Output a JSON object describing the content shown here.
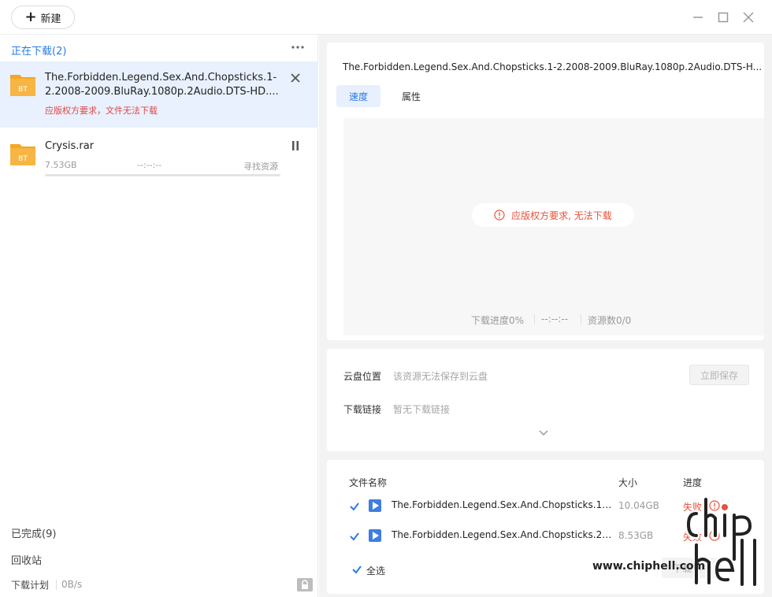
{
  "toolbar": {
    "new_label": "新建"
  },
  "window_controls": [
    "minimize-icon",
    "maximize-icon",
    "close-icon"
  ],
  "sidebar": {
    "downloading_title": "正在下载(2)",
    "tasks": [
      {
        "name": "The.Forbidden.Legend.Sex.And.Chopsticks.1-2.2008-2009.BluRay.1080p.2Audio.DTS-HD....",
        "icon": "bt-folder-icon",
        "icon_text": "BT",
        "error": "应版权方要求，文件无法下载",
        "action_icon": "close-icon"
      },
      {
        "name": "Crysis.rar",
        "icon": "bt-folder-icon",
        "icon_text": "BT",
        "size": "7.53GB",
        "eta": "--:--:--",
        "status": "寻找资源",
        "action_icon": "pause-icon",
        "progress": 0
      }
    ],
    "completed": "已完成(9)",
    "recycle": "回收站",
    "plan": "下载计划",
    "speed": "0B/s"
  },
  "detail": {
    "title": "The.Forbidden.Legend.Sex.And.Chopsticks.1-2.2008-2009.BluRay.1080p.2Audio.DTS-H...",
    "tabs": [
      "速度",
      "属性"
    ],
    "error_message": "应版权方要求, 无法下载",
    "progress_text": "下载进度0%",
    "eta_text": "--:--:--",
    "sources_text": "资源数0/0",
    "cloud_label": "云盘位置",
    "cloud_value": "该资源无法保存到云盘",
    "save_button": "立即保存",
    "link_label": "下载链接",
    "link_value": "暂无下载链接"
  },
  "file_list": {
    "headers": {
      "name": "文件名称",
      "size": "大小",
      "progress": "进度"
    },
    "rows": [
      {
        "checked": true,
        "name": "The.Forbidden.Legend.Sex.And.Chopsticks.1....",
        "size": "10.04GB",
        "status": "失败"
      },
      {
        "checked": true,
        "name": "The.Forbidden.Legend.Sex.And.Chopsticks.2....",
        "size": "8.53GB",
        "status": "失败"
      }
    ],
    "select_all": "全选",
    "download_selected": "下载选中"
  },
  "watermark": "www.chiphell.com",
  "colors": {
    "accent": "#2a7ae6",
    "error": "#e8523b",
    "folder": "#f5a623"
  }
}
